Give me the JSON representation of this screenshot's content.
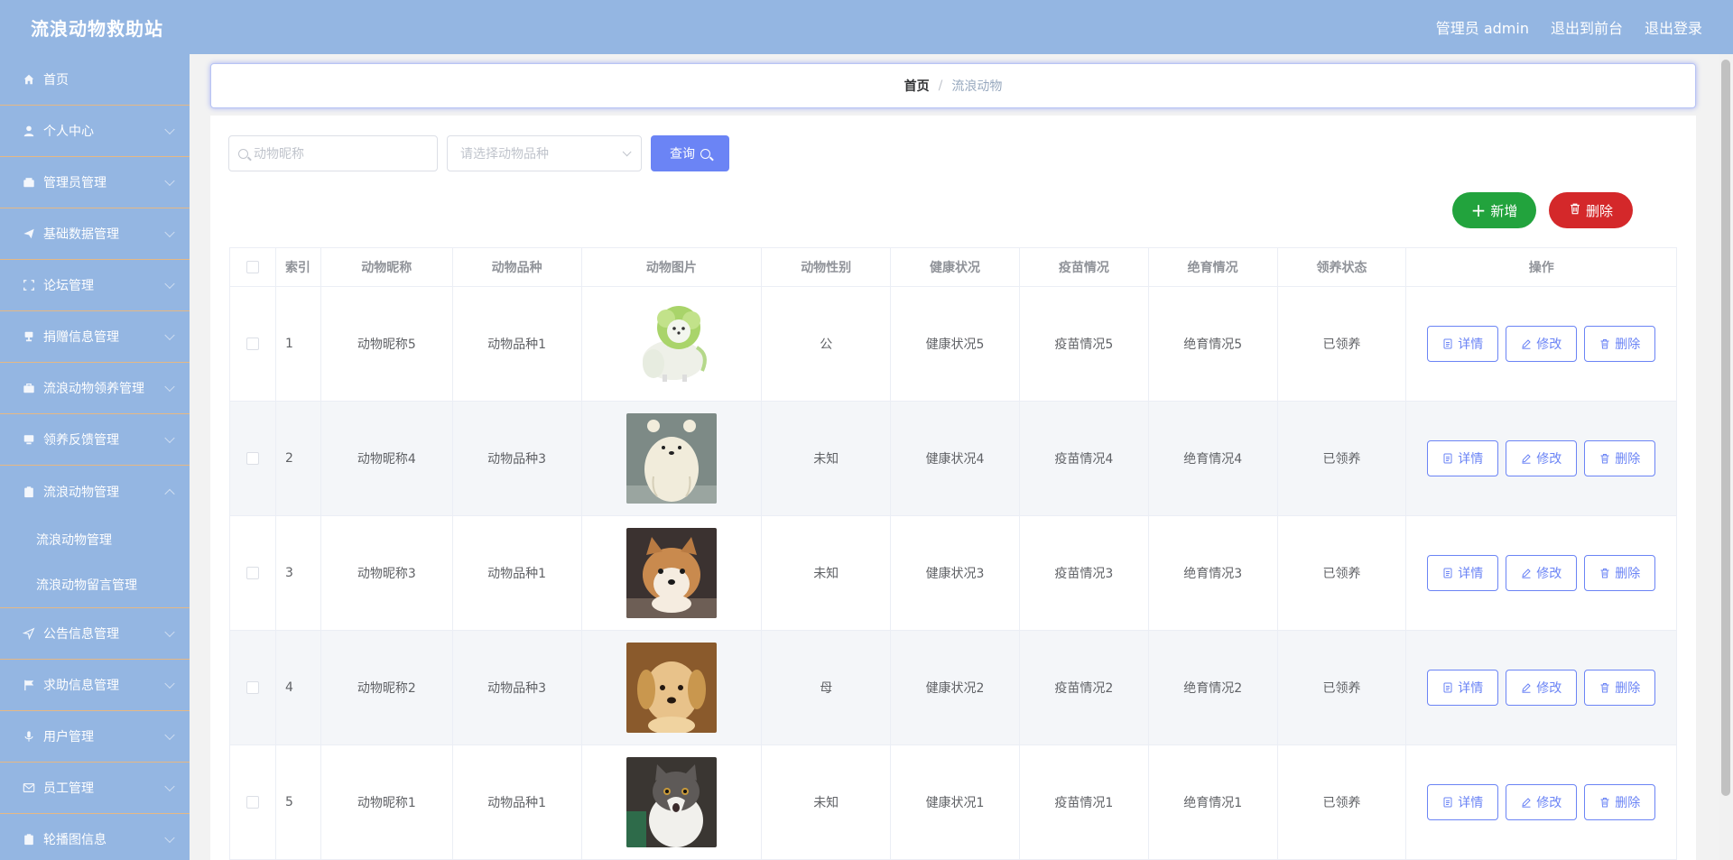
{
  "header": {
    "title": "流浪动物救助站",
    "user": "管理员 admin",
    "to_front": "退出到前台",
    "logout": "退出登录"
  },
  "sidebar": {
    "items": [
      {
        "label": "首页",
        "icon": "home-icon"
      },
      {
        "label": "个人中心",
        "icon": "user-icon"
      },
      {
        "label": "管理员管理",
        "icon": "wallet-icon"
      },
      {
        "label": "基础数据管理",
        "icon": "send-icon"
      },
      {
        "label": "论坛管理",
        "icon": "frame-icon"
      },
      {
        "label": "捐赠信息管理",
        "icon": "cup-icon"
      },
      {
        "label": "流浪动物领养管理",
        "icon": "briefcase-icon"
      },
      {
        "label": "领养反馈管理",
        "icon": "monitor-icon"
      },
      {
        "label": "流浪动物管理",
        "icon": "clipboard-icon"
      },
      {
        "label": "公告信息管理",
        "icon": "location-icon"
      },
      {
        "label": "求助信息管理",
        "icon": "flag-icon"
      },
      {
        "label": "用户管理",
        "icon": "mic-icon"
      },
      {
        "label": "员工管理",
        "icon": "message-icon"
      },
      {
        "label": "轮播图信息",
        "icon": "document-icon"
      }
    ],
    "submenu": [
      "流浪动物管理",
      "流浪动物留言管理"
    ]
  },
  "breadcrumb": {
    "home": "首页",
    "current": "流浪动物"
  },
  "search": {
    "name_placeholder": "动物昵称",
    "breed_placeholder": "请选择动物品种",
    "query_label": "查询"
  },
  "actions": {
    "add_label": "新增",
    "delete_label": "删除"
  },
  "table": {
    "headers": [
      "索引",
      "动物昵称",
      "动物品种",
      "动物图片",
      "动物性别",
      "健康状况",
      "疫苗情况",
      "绝育情况",
      "领养状态",
      "操作"
    ],
    "op_labels": {
      "detail": "详情",
      "edit": "修改",
      "delete": "删除"
    },
    "rows": [
      {
        "idx": "1",
        "name": "动物昵称5",
        "breed": "动物品种1",
        "sex": "公",
        "health": "健康状况5",
        "vaccine": "疫苗情况5",
        "sterilize": "绝育情况5",
        "adopt": "已领养",
        "image": "cabbage-dog-photo"
      },
      {
        "idx": "2",
        "name": "动物昵称4",
        "breed": "动物品种3",
        "sex": "未知",
        "health": "健康状况4",
        "vaccine": "疫苗情况4",
        "sterilize": "绝育情况4",
        "adopt": "已领养",
        "image": "polar-bear-cartoon-photo"
      },
      {
        "idx": "3",
        "name": "动物昵称3",
        "breed": "动物品种1",
        "sex": "未知",
        "health": "健康状况3",
        "vaccine": "疫苗情况3",
        "sterilize": "绝育情况3",
        "adopt": "已领养",
        "image": "shiba-puppy-photo"
      },
      {
        "idx": "4",
        "name": "动物昵称2",
        "breed": "动物品种3",
        "sex": "母",
        "health": "健康状况2",
        "vaccine": "疫苗情况2",
        "sterilize": "绝育情况2",
        "adopt": "已领养",
        "image": "golden-puppy-photo"
      },
      {
        "idx": "5",
        "name": "动物昵称1",
        "breed": "动物品种1",
        "sex": "未知",
        "health": "健康状况1",
        "vaccine": "疫苗情况1",
        "sterilize": "绝育情况1",
        "adopt": "已领养",
        "image": "surprised-cat-photo"
      }
    ]
  },
  "colors": {
    "primary": "#6b84f5",
    "header_bg": "#94b6e2",
    "add": "#22a33d",
    "danger": "#d4282a"
  }
}
